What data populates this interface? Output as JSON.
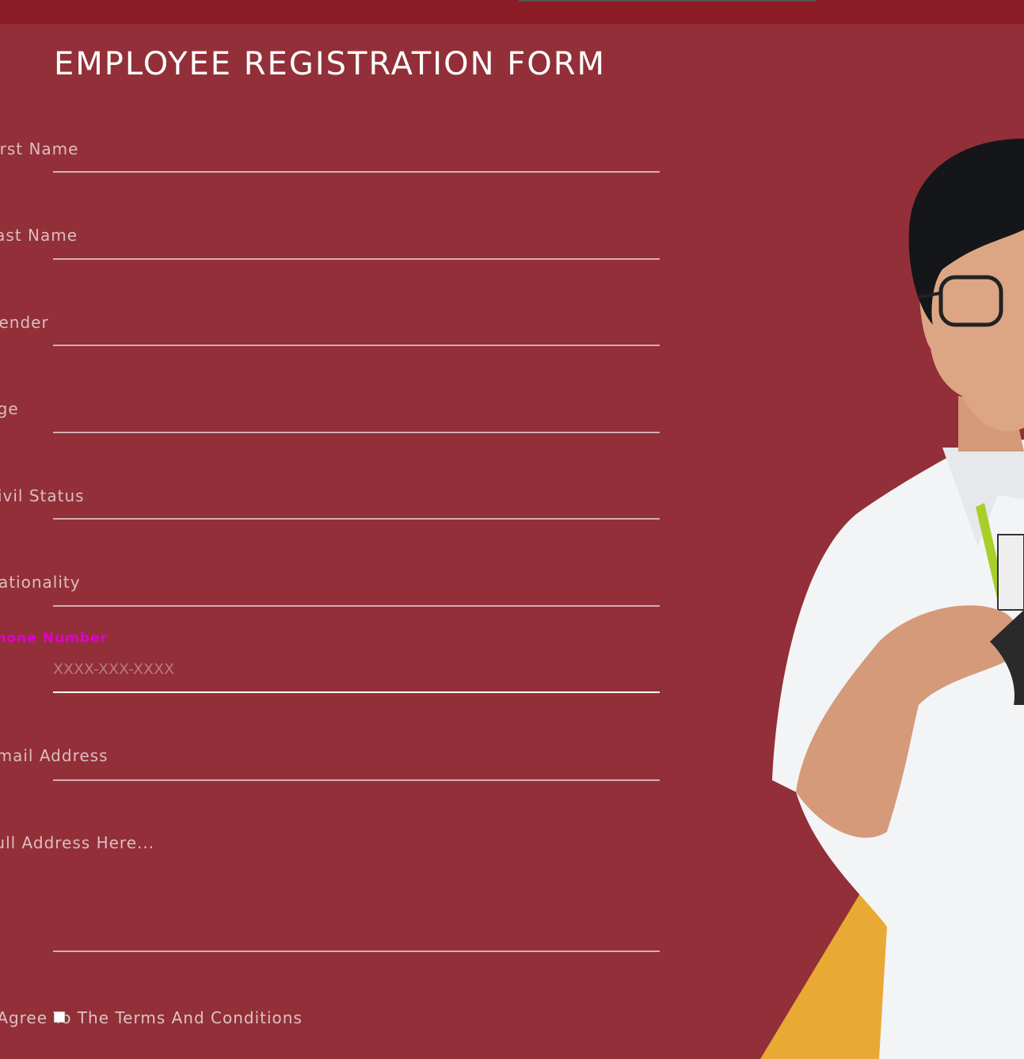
{
  "page": {
    "title": "EMPLOYEE REGISTRATION FORM",
    "background_color": "#922f38",
    "topbar_color": "#8b1b24",
    "accent_color": "#e100d2",
    "decor_color": "#e8a935"
  },
  "form": {
    "first_name_label": "First Name",
    "last_name_label": "Last Name",
    "gender_label": "Gender",
    "age_label": "Age",
    "civil_status_label": "Civil Status",
    "nationality_label": "Nationality",
    "phone_label": "Phone Number",
    "phone_placeholder": "XXXX-XXX-XXXX",
    "email_label": "Email Address",
    "address_label": "Full Address Here...",
    "terms_label": "I Agree To The Terms And Conditions"
  },
  "image": {
    "subject": "employee-photo"
  }
}
